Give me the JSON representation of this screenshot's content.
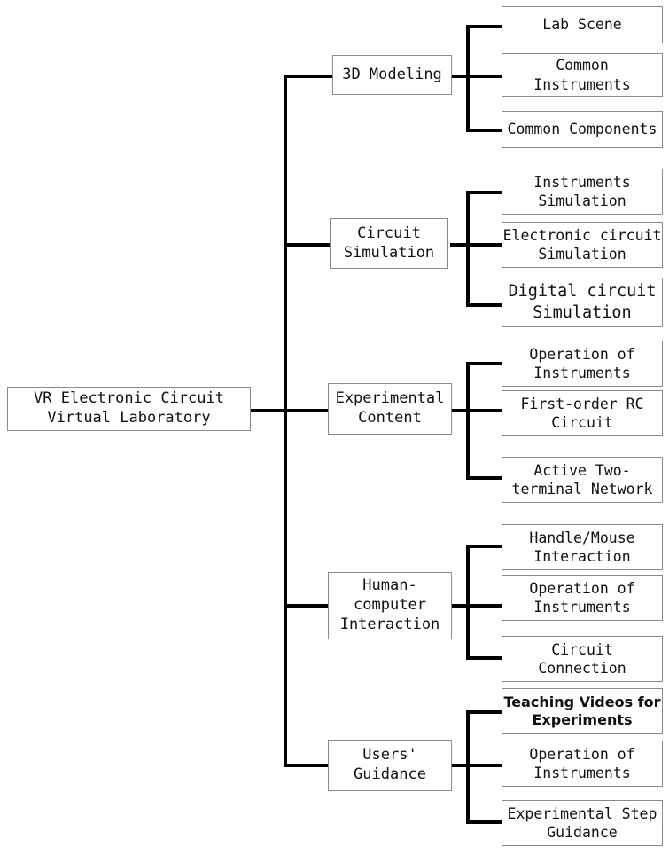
{
  "diagram": {
    "title": "VR Electronic Circuit Virtual Laboratory structure tree",
    "type": "tree",
    "orientation": "left-to-right",
    "colors": {
      "box_border": "#8a8a8a",
      "connector": "#000000",
      "background": "#ffffff",
      "text": "#111111"
    },
    "root": {
      "label": "VR Electronic Circuit\nVirtual Laboratory"
    },
    "branches": [
      {
        "label": "3D Modeling",
        "children": [
          {
            "label": "Lab Scene"
          },
          {
            "label": "Common\nInstruments"
          },
          {
            "label": "Common Components"
          }
        ]
      },
      {
        "label": "Circuit\nSimulation",
        "children": [
          {
            "label": "Instruments\nSimulation"
          },
          {
            "label": "Electronic circuit\nSimulation"
          },
          {
            "label": "Digital circuit\nSimulation"
          }
        ]
      },
      {
        "label": "Experimental\nContent",
        "children": [
          {
            "label": "Operation of\nInstruments"
          },
          {
            "label": "First-order RC\nCircuit"
          },
          {
            "label": "Active Two-\nterminal Network"
          }
        ]
      },
      {
        "label": "Human-\ncomputer\nInteraction",
        "children": [
          {
            "label": "Handle/Mouse\nInteraction"
          },
          {
            "label": "Operation of\nInstruments"
          },
          {
            "label": "Circuit\nConnection"
          }
        ]
      },
      {
        "label": "Users'\nGuidance",
        "children": [
          {
            "label": "Teaching Videos for\nExperiments"
          },
          {
            "label": "Operation of\nInstruments"
          },
          {
            "label": "Experimental Step\nGuidance"
          }
        ]
      }
    ]
  }
}
